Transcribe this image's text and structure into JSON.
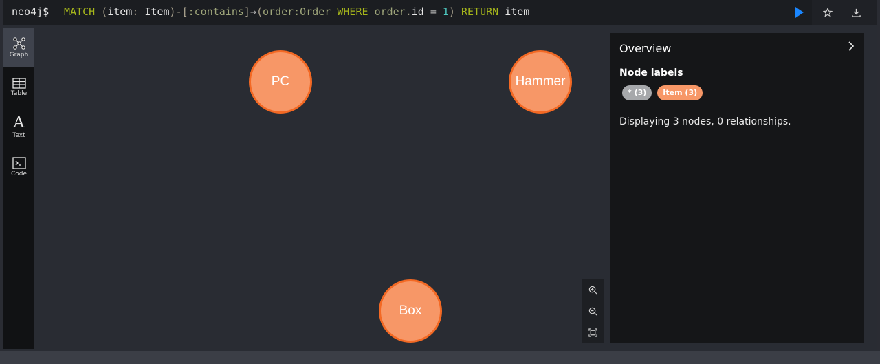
{
  "query": {
    "prompt": "neo4j$",
    "tokens": [
      {
        "t": "MATCH",
        "c": "kw"
      },
      {
        "t": " ",
        "c": "id"
      },
      {
        "t": "(",
        "c": "punc"
      },
      {
        "t": "item",
        "c": "id"
      },
      {
        "t": ": ",
        "c": "punc"
      },
      {
        "t": "Item",
        "c": "id"
      },
      {
        "t": ")",
        "c": "punc"
      },
      {
        "t": "-[",
        "c": "punc"
      },
      {
        "t": ":contains",
        "c": "lab"
      },
      {
        "t": "]",
        "c": "punc"
      },
      {
        "t": "→",
        "c": "op"
      },
      {
        "t": "(",
        "c": "punc"
      },
      {
        "t": "order",
        "c": "lab"
      },
      {
        "t": ":Order",
        "c": "lab"
      },
      {
        "t": " ",
        "c": "id"
      },
      {
        "t": "WHERE",
        "c": "kw"
      },
      {
        "t": " ",
        "c": "id"
      },
      {
        "t": "order",
        "c": "lab"
      },
      {
        "t": ".",
        "c": "punc"
      },
      {
        "t": "id",
        "c": "id"
      },
      {
        "t": " = ",
        "c": "op"
      },
      {
        "t": "1",
        "c": "num"
      },
      {
        "t": ")",
        "c": "punc"
      },
      {
        "t": " ",
        "c": "id"
      },
      {
        "t": "RETURN",
        "c": "kw"
      },
      {
        "t": " ",
        "c": "id"
      },
      {
        "t": "item",
        "c": "id"
      }
    ]
  },
  "sidebar": {
    "items": [
      {
        "label": "Graph",
        "icon": "graph-icon"
      },
      {
        "label": "Table",
        "icon": "table-icon"
      },
      {
        "label": "Text",
        "icon": "text-icon"
      },
      {
        "label": "Code",
        "icon": "code-icon"
      }
    ]
  },
  "nodes": [
    {
      "label": "PC"
    },
    {
      "label": "Hammer"
    },
    {
      "label": "Box"
    }
  ],
  "overview": {
    "title": "Overview",
    "subtitle": "Node labels",
    "chips": [
      {
        "label": "* (3)",
        "kind": "all"
      },
      {
        "label": "Item (3)",
        "kind": "item"
      }
    ],
    "summary": "Displaying 3 nodes, 0 relationships."
  },
  "colors": {
    "node_fill": "#f79767",
    "node_border": "#f36924",
    "run_button": "#1a86ff"
  }
}
